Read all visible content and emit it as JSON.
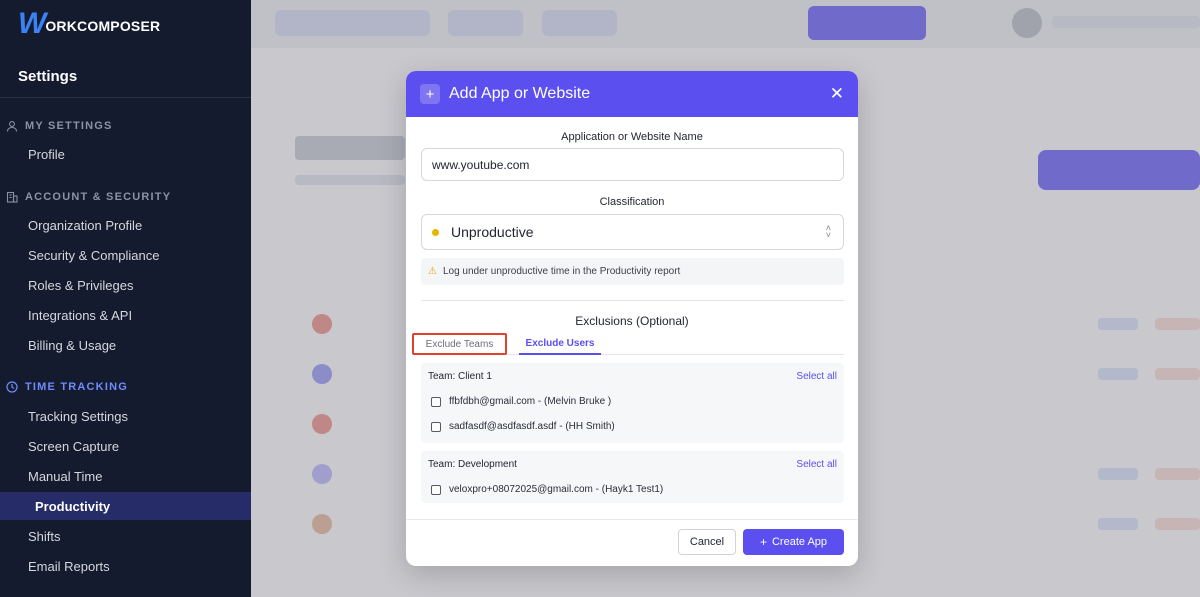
{
  "sidebar": {
    "logo_mark": "W",
    "logo_text": "ORKCOMPOSER",
    "title": "Settings",
    "sections": [
      {
        "label": "MY SETTINGS",
        "icon": "user-icon",
        "items": [
          "Profile"
        ]
      },
      {
        "label": "ACCOUNT & SECURITY",
        "icon": "building-icon",
        "items": [
          "Organization Profile",
          "Security & Compliance",
          "Roles & Privileges",
          "Integrations & API",
          "Billing & Usage"
        ]
      },
      {
        "label": "TIME TRACKING",
        "icon": "clock-icon",
        "items": [
          "Tracking Settings",
          "Screen Capture",
          "Manual Time",
          "Productivity",
          "Shifts",
          "Email Reports"
        ]
      }
    ],
    "active_item": "Productivity"
  },
  "modal": {
    "title": "Add App or Website",
    "name_label": "Application or Website Name",
    "name_value": "www.youtube.com",
    "classification_label": "Classification",
    "classification_value": "Unproductive",
    "classification_dot_color": "#e8b400",
    "hint": "Log under unproductive time in the Productivity report",
    "exclusions_title": "Exclusions (Optional)",
    "tabs": [
      "Exclude Teams",
      "Exclude Users"
    ],
    "teams": [
      {
        "name": "Team: Client 1",
        "select_all": "Select all",
        "members": [
          "ffbfdbh@gmail.com - (Melvin Bruke )",
          "sadfasdf@asdfasdf.asdf - (HH Smith)"
        ]
      },
      {
        "name": "Team: Development",
        "select_all": "Select all",
        "members": [
          "veloxpro+08072025@gmail.com - (Hayk1 Test1)"
        ]
      }
    ],
    "cancel_label": "Cancel",
    "create_label": "Create App"
  },
  "colors": {
    "accent": "#5b4ff0",
    "sidebar_bg": "#151b2e",
    "highlight_border": "#e0412f"
  }
}
